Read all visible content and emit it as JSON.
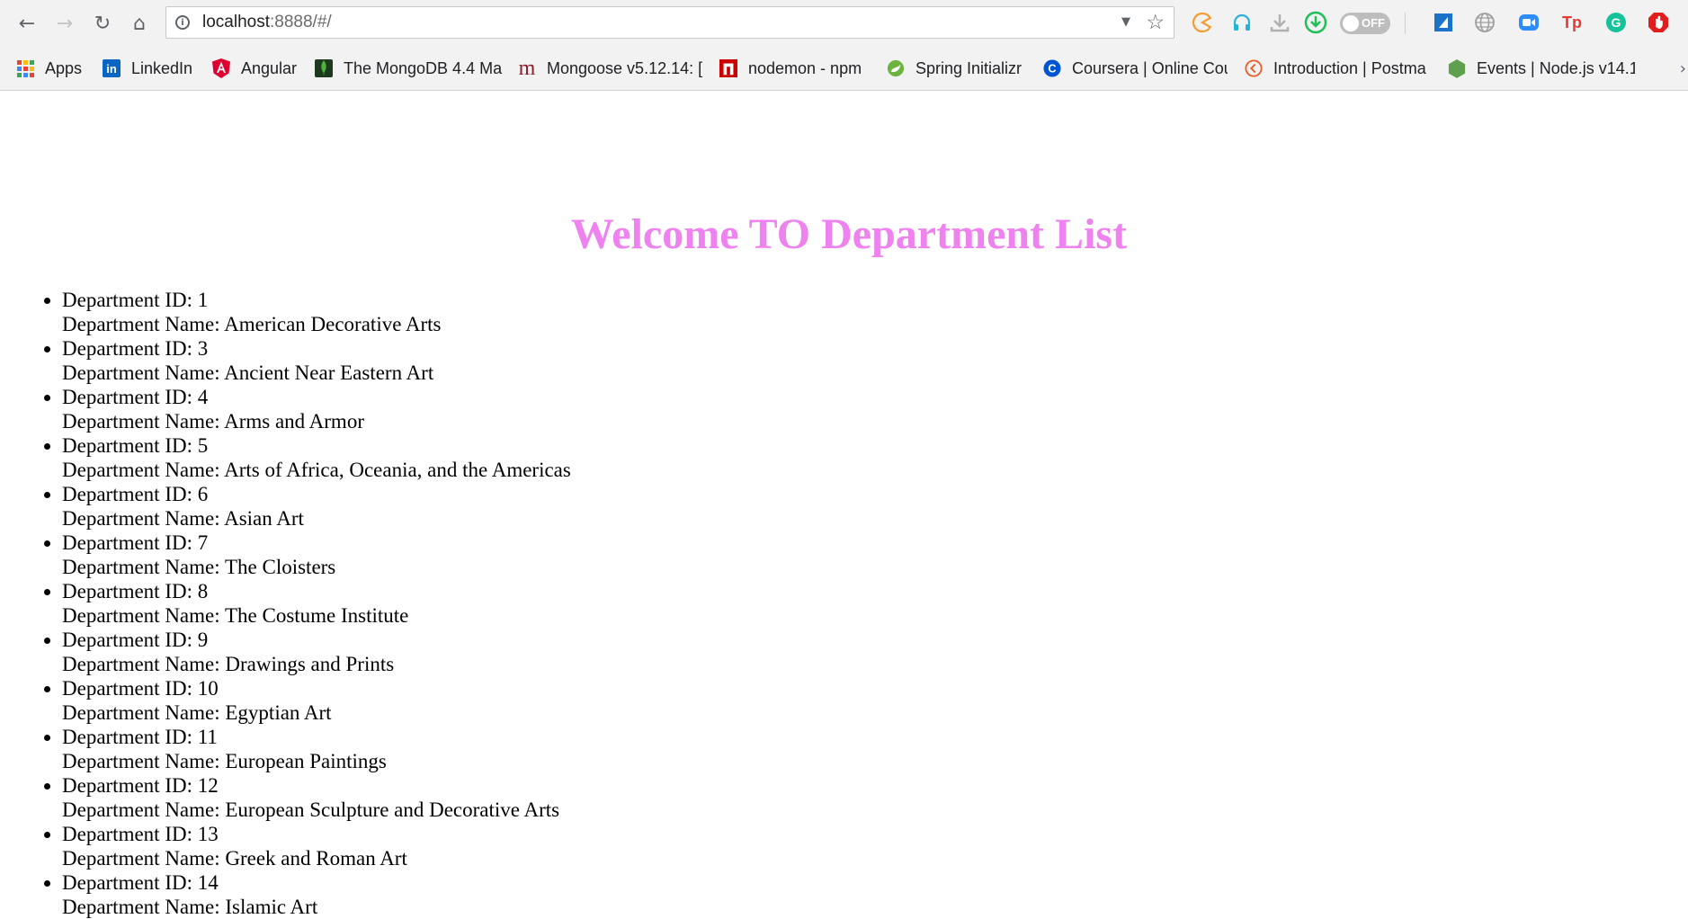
{
  "browser": {
    "url_host": "localhost",
    "url_rest": ":8888/#/",
    "toggle_label": "OFF",
    "extensions": [
      "pacman-icon",
      "headphones-icon",
      "download-icon",
      "green-download-icon",
      "toggle-off",
      "blue-square-icon",
      "globe-icon",
      "zoom-icon",
      "tp-icon",
      "grammarly-icon",
      "adblock-icon"
    ]
  },
  "bookmarks": [
    {
      "label": "Apps",
      "icon": "apps-grid-icon"
    },
    {
      "label": "LinkedIn",
      "icon": "linkedin-icon"
    },
    {
      "label": "Angular",
      "icon": "angular-icon"
    },
    {
      "label": "The MongoDB 4.4 Ma",
      "icon": "mongodb-icon"
    },
    {
      "label": "Mongoose v5.12.14: [",
      "icon": "mongoose-icon"
    },
    {
      "label": "nodemon - npm",
      "icon": "npm-icon"
    },
    {
      "label": "Spring Initializr",
      "icon": "spring-icon"
    },
    {
      "label": "Coursera | Online Cou",
      "icon": "coursera-icon"
    },
    {
      "label": "Introduction | Postma",
      "icon": "postman-icon"
    },
    {
      "label": "Events | Node.js v14.1",
      "icon": "nodejs-icon"
    }
  ],
  "page": {
    "title": "Welcome TO Department List",
    "title_color": "#ee82ee",
    "id_prefix": "Department ID: ",
    "name_prefix": "Department Name: ",
    "departments": [
      {
        "id": "1",
        "name": "American Decorative Arts"
      },
      {
        "id": "3",
        "name": "Ancient Near Eastern Art"
      },
      {
        "id": "4",
        "name": "Arms and Armor"
      },
      {
        "id": "5",
        "name": "Arts of Africa, Oceania, and the Americas"
      },
      {
        "id": "6",
        "name": "Asian Art"
      },
      {
        "id": "7",
        "name": "The Cloisters"
      },
      {
        "id": "8",
        "name": "The Costume Institute"
      },
      {
        "id": "9",
        "name": "Drawings and Prints"
      },
      {
        "id": "10",
        "name": "Egyptian Art"
      },
      {
        "id": "11",
        "name": "European Paintings"
      },
      {
        "id": "12",
        "name": "European Sculpture and Decorative Arts"
      },
      {
        "id": "13",
        "name": "Greek and Roman Art"
      },
      {
        "id": "14",
        "name": "Islamic Art"
      }
    ]
  }
}
